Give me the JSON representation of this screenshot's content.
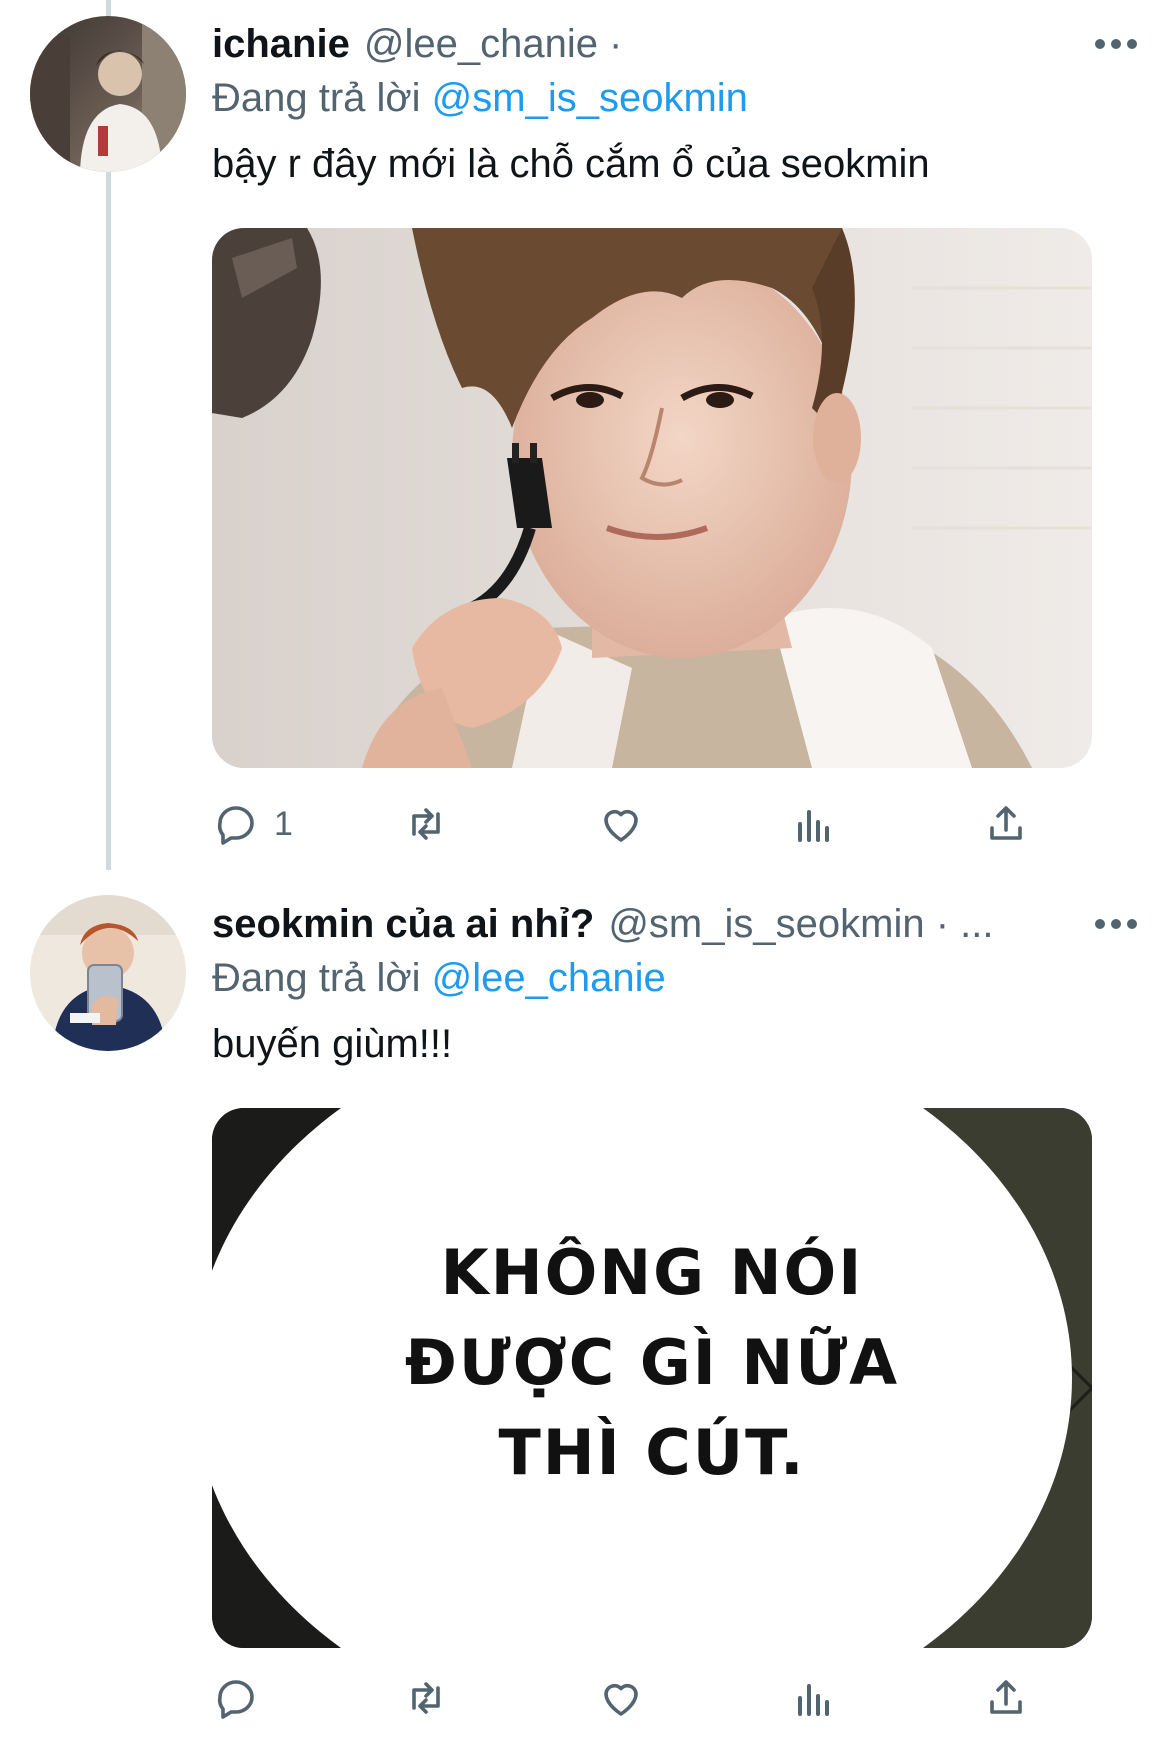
{
  "tweets": [
    {
      "display_name": "ichanie",
      "handle": "@lee_chanie ·",
      "more": "",
      "replying_prefix": "Đang trả lời",
      "replying_to": "@sm_is_seokmin",
      "text": "bậy r đây mới là chỗ cắm ổ của seokmin",
      "media": {
        "type": "photo"
      },
      "actions": {
        "reply_count": "1",
        "retweet_count": "",
        "like_count": "",
        "views_count": ""
      }
    },
    {
      "display_name": "seokmin của ai nhỉ?",
      "handle": "@sm_is_seokmin · ...",
      "more": "",
      "replying_prefix": "Đang trả lời",
      "replying_to": "@lee_chanie",
      "text": "buyến giùm!!!",
      "media": {
        "type": "meme",
        "lines": [
          "KHÔNG NÓI",
          "ĐƯỢC GÌ NỮA",
          "THÌ CÚT."
        ]
      },
      "actions": {
        "reply_count": "",
        "retweet_count": "",
        "like_count": "",
        "views_count": ""
      }
    }
  ],
  "icons": {
    "more": "more-horizontal-icon",
    "reply": "reply-bubble-icon",
    "retweet": "retweet-icon",
    "like": "heart-icon",
    "views": "views-bar-chart-icon",
    "share": "share-upload-icon"
  },
  "colors": {
    "text": "#0f1419",
    "secondary": "#536471",
    "accent": "#1d9bf0",
    "thread_line": "#cfd9de"
  }
}
